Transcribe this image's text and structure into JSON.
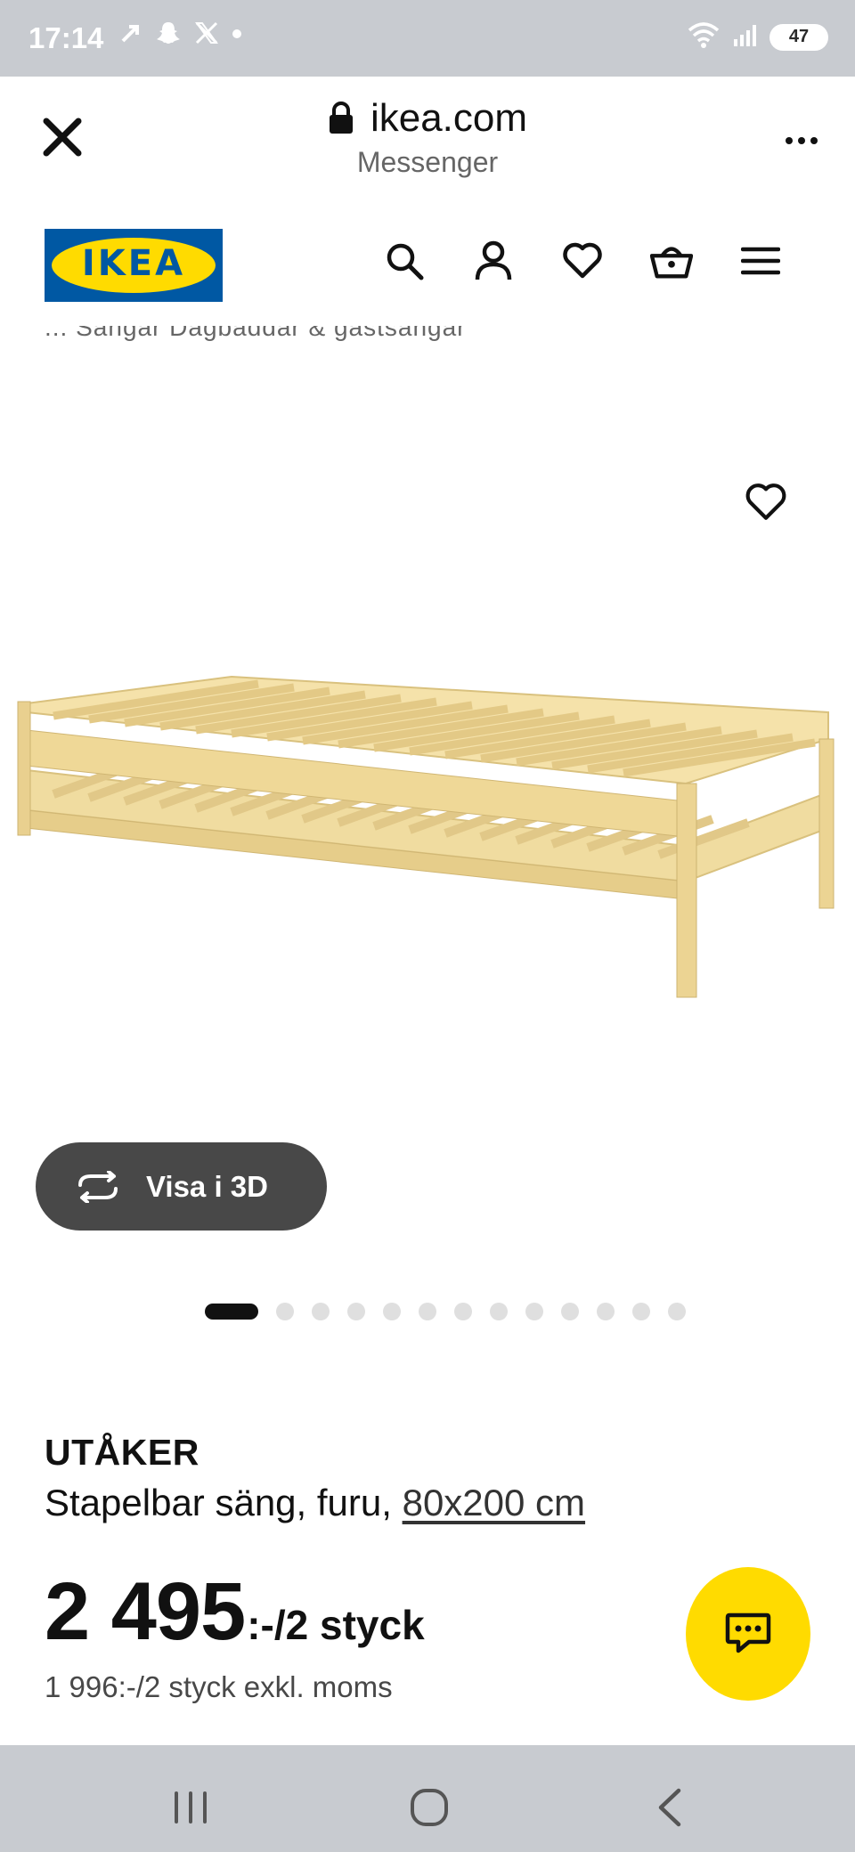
{
  "status_bar": {
    "time": "17:14",
    "icons_left": [
      "navigation-icon",
      "snapchat-icon",
      "x-icon",
      "dot-icon"
    ],
    "icons_right": [
      "wifi-icon",
      "signal-icon"
    ],
    "battery": "47"
  },
  "browser": {
    "url": "ikea.com",
    "source": "Messenger"
  },
  "header": {
    "logo_text": "IKEA",
    "icons": [
      "search-icon",
      "user-icon",
      "heart-icon",
      "basket-icon",
      "menu-icon"
    ]
  },
  "breadcrumb": "...    Sängar    Dagbäddar & gästsängar",
  "product": {
    "view_3d_label": "Visa i 3D",
    "name": "UTÅKER",
    "description_prefix": "Stapelbar säng, furu, ",
    "size_link": "80x200 cm",
    "price": "2 495",
    "price_suffix": ":-/2 styck",
    "price_ex_vat": "1 996:-/2 styck exkl. moms"
  },
  "carousel": {
    "total_images": 13,
    "active_index": 0
  },
  "colors": {
    "ikea_blue": "#0058a3",
    "ikea_yellow": "#ffdb00",
    "system_bar": "#c8cbd0"
  }
}
